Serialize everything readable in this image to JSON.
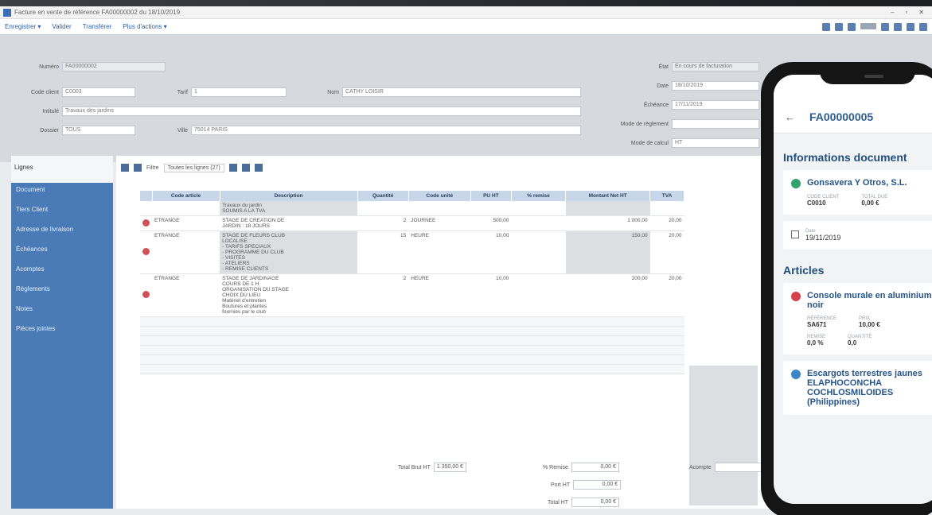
{
  "window": {
    "title": "Facture en vente de référence FA00000002 du 18/10/2019",
    "controls": [
      "–",
      "▫",
      "✕"
    ]
  },
  "menu": {
    "items": [
      "Enregistrer ▾",
      "Valider",
      "Transférer",
      "Plus d'actions ▾"
    ]
  },
  "header_fields": {
    "numero": {
      "label": "Numéro",
      "value": "FA00000002"
    },
    "client": {
      "label": "Code client",
      "value": "C0003"
    },
    "tarif": {
      "label": "Tarif",
      "value": "1"
    },
    "nom": {
      "label": "Nom",
      "value": "CATHY LOISIR"
    },
    "intitule": {
      "label": "Intitulé",
      "value": "Travaux des jardins"
    },
    "dossier": {
      "label": "Dossier",
      "value": "TOUS"
    },
    "ville": {
      "label": "Ville",
      "value": "75014 PARIS"
    },
    "etat": {
      "label": "État",
      "value": "En cours de facturation"
    },
    "date": {
      "label": "Date",
      "value": "18/10/2019"
    },
    "echeance": {
      "label": "Échéance",
      "value": "17/11/2019"
    },
    "mode_reglement": {
      "label": "Mode de règlement",
      "value": ""
    },
    "mode_calcul": {
      "label": "Mode de calcul",
      "value": "HT"
    }
  },
  "sidebar": {
    "header": "Lignes",
    "items": [
      "Document",
      "Tiers Client",
      "Adresse de livraison",
      "Échéances",
      "Acomptes",
      "Règlements",
      "Notes",
      "Pièces jointes"
    ]
  },
  "toolbar": {
    "filter_label": "Filtre",
    "filter_value": "Toutes les lignes (27)"
  },
  "table": {
    "columns": [
      "Code article",
      "Description",
      "Quantité",
      "Code unité",
      "PU HT",
      "% remise",
      "Montant Net HT",
      "TVA"
    ],
    "rows": [
      {
        "del": false,
        "code": "",
        "desc": "Travaux du jardin\nSOUMIS A LA TVA",
        "qty": "",
        "unit": "",
        "pu": "",
        "remise": "",
        "montant": "",
        "tva": "",
        "shade": true
      },
      {
        "del": true,
        "code": "ETRANGE",
        "desc": "STAGE DE CREATION DE\nJARDIN : 18 JOURS",
        "qty": "2",
        "unit": "JOURNEE",
        "pu": "500,00",
        "remise": "",
        "montant": "1 000,00",
        "tva": "20,00",
        "shade": false
      },
      {
        "del": true,
        "code": "ETRANGE",
        "desc": "STAGE DE FLEURS CLUB\nLOCALISE\n- TARIFS SPECIAUX\n- PROGRAMME DU CLUB\n- VISITES\n- ATELIERS\n- REMISE CLIENTS",
        "qty": "15",
        "unit": "HEURE",
        "pu": "10,00",
        "remise": "",
        "montant": "150,00",
        "tva": "20,00",
        "shade": true
      },
      {
        "del": true,
        "code": "ETRANGE",
        "desc": "STAGE DE JARDINAGE\nCOURS DE 1 H\nORGANISATION DU STAGE\nCHOIX DU LIEU\nMatériel d'entretien\nBoutures et plantes\nfournies par le club",
        "qty": "2",
        "unit": "HEURE",
        "pu": "10,00",
        "remise": "",
        "montant": "200,00",
        "tva": "20,00",
        "shade": false
      }
    ]
  },
  "totals": {
    "total_brut_label": "Total Brut HT",
    "total_brut": "1 350,00 €",
    "remise_label": "% Remise",
    "remise": "0,00 €",
    "port_label": "Port HT",
    "port": "0,00 €",
    "total_ht_label": "Total HT",
    "total_ht": "0,00 €",
    "acompte_label": "Acompte",
    "acompte": ""
  },
  "phone": {
    "doc_number": "FA00000005",
    "section_info": "Informations document",
    "customer_name": "Gonsavera Y Otros, S.L.",
    "customer_code_label": "CODE CLIENT",
    "customer_code": "C0010",
    "total_label": "TOTAL DUE",
    "total_value": "0,00 €",
    "date_label": "Date",
    "date_value": "19/11/2019",
    "section_articles": "Articles",
    "article1_name": "Console murale en aluminium noir",
    "article1_ref_label": "RÉFÉRENCE",
    "article1_ref": "SA671",
    "article1_price_label": "PRIX",
    "article1_price": "10,00 €",
    "article1_rem_label": "REMISE",
    "article1_rem": "0,0 %",
    "article1_qty_label": "QUANTITÉ",
    "article1_qty": "0,0",
    "article2_name": "Escargots terrestres jaunes ELAPHOCONCHA COCHLOSMILOIDES (Philippines)",
    "colors": {
      "red": "#d6404b",
      "green": "#2fa36b",
      "blue": "#3a86c8"
    }
  }
}
